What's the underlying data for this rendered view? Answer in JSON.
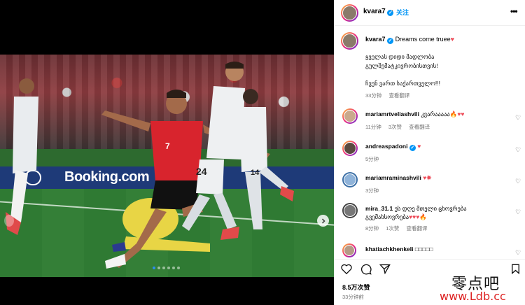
{
  "header": {
    "username": "kvara7",
    "follow_label": "关注",
    "separator": "·",
    "more_label": "•••"
  },
  "caption": {
    "username": "kvara7",
    "text": "Dreams come truee",
    "heart": "♥",
    "lines": [
      "ყველას დიდი მადლობა",
      "გულშემატკივრობისთვის!",
      "ჩვენ ვართ საქართველო!!!"
    ],
    "time": "33分钟",
    "translate": "查看翻译"
  },
  "comments": [
    {
      "username": "mariamrtveliashvili",
      "text": "კვარააააა",
      "emojis": "🔥♥♥",
      "time": "11分钟",
      "likes": "3次赞",
      "translate": "查看翻译",
      "verified": false
    },
    {
      "username": "andreaspadoni",
      "text": "",
      "emojis": "♥",
      "time": "5分钟",
      "likes": "",
      "translate": "",
      "verified": true
    },
    {
      "username": "mariamraminashvili",
      "text": "",
      "emojis": "♥✵",
      "time": "3分钟",
      "likes": "",
      "translate": "",
      "verified": false
    },
    {
      "username": "mira_31.1",
      "text": "ეს დღე მთელი ცხოვრება",
      "text2": "გვემახსოვრება",
      "emojis": "♥♥♥🔥",
      "time": "8分钟",
      "likes": "1次赞",
      "translate": "查看翻译",
      "verified": false
    },
    {
      "username": "khatiachkhenkeli",
      "text": "□□□□□",
      "emojis": "",
      "time": "",
      "likes": "",
      "translate": "",
      "verified": false
    }
  ],
  "actions": {
    "like_icon": "heart-outline-icon",
    "comment_icon": "comment-icon",
    "share_icon": "paper-plane-icon",
    "save_icon": "bookmark-icon"
  },
  "likes_count": "8.5万次赞",
  "posted_time": "33分钟前",
  "photo": {
    "ad_text": "Booking.com",
    "jersey_red": "7",
    "jersey_white_1": "24",
    "jersey_white_2": "14"
  },
  "watermark": {
    "line1": "零点吧",
    "line2": "www.Ldb.cc"
  },
  "colors": {
    "accent": "#0095f6",
    "heart": "#ed4956",
    "muted": "#737373"
  }
}
